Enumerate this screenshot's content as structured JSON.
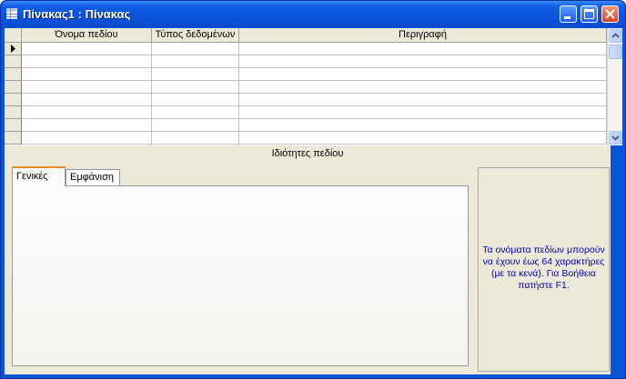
{
  "window": {
    "title": "Πίνακας1 : Πίνακας"
  },
  "grid": {
    "columns": [
      "Όνομα πεδίου",
      "Τύπος δεδομένων",
      "Περιγραφή"
    ],
    "row_count": 8
  },
  "properties": {
    "header": "Ιδιότητες πεδίου",
    "tabs": [
      {
        "label": "Γενικές",
        "active": true
      },
      {
        "label": "Εμφάνιση",
        "active": false
      }
    ],
    "help_text": "Τα ονόματα πεδίων μπορούν να έχουν έως 64 χαρακτήρες (με τα κενά). Για Βοήθεια πατήστε F1."
  },
  "colors": {
    "titlebar": "#0a55dc",
    "help_text": "#0000c8",
    "tab_accent": "#e68b2c"
  },
  "icons": {
    "window": "table-icon",
    "minimize": "minimize-icon",
    "maximize": "maximize-icon",
    "close": "close-icon",
    "row_selector": "record-pointer-icon"
  }
}
